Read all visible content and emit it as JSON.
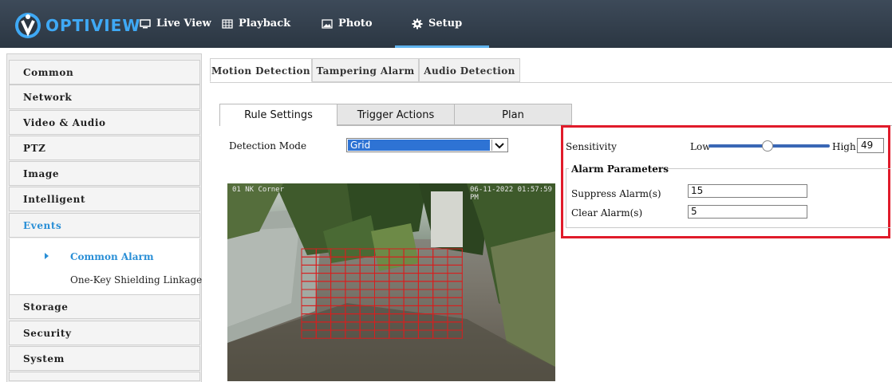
{
  "header": {
    "brand": "OPTIVIEW",
    "nav": [
      {
        "label": "Live View",
        "icon": "monitor-icon"
      },
      {
        "label": "Playback",
        "icon": "film-icon"
      },
      {
        "label": "Photo",
        "icon": "image-icon"
      },
      {
        "label": "Setup",
        "icon": "gear-icon",
        "active": true
      }
    ]
  },
  "sidebar": {
    "items": [
      {
        "label": "Common"
      },
      {
        "label": "Network"
      },
      {
        "label": "Video & Audio"
      },
      {
        "label": "PTZ"
      },
      {
        "label": "Image"
      },
      {
        "label": "Intelligent"
      },
      {
        "label": "Events",
        "active": true
      },
      {
        "label": "Storage"
      },
      {
        "label": "Security"
      },
      {
        "label": "System"
      }
    ],
    "events_sub": [
      {
        "label": "Common Alarm",
        "active": true
      },
      {
        "label": "One-Key Shielding Linkage"
      }
    ]
  },
  "main_tabs": [
    "Motion Detection",
    "Tampering Alarm",
    "Audio Detection"
  ],
  "sub_tabs": [
    "Rule Settings",
    "Trigger Actions",
    "Plan"
  ],
  "detection": {
    "mode_label": "Detection Mode",
    "mode_value": "Grid"
  },
  "video": {
    "osd_left": "01  NK Corner",
    "osd_right": "06-11-2022 01:57:59 PM"
  },
  "sensitivity": {
    "label": "Sensitivity",
    "low": "Low",
    "high": "High",
    "value": "49"
  },
  "alarm": {
    "legend": "Alarm Parameters",
    "suppress_label": "Suppress Alarm(s)",
    "suppress_value": "15",
    "clear_label": "Clear Alarm(s)",
    "clear_value": "5"
  },
  "colors": {
    "accent": "#2a8fd6",
    "highlight": "#e01b2a",
    "grid": "#d81e1e",
    "select": "#2e73d4"
  }
}
